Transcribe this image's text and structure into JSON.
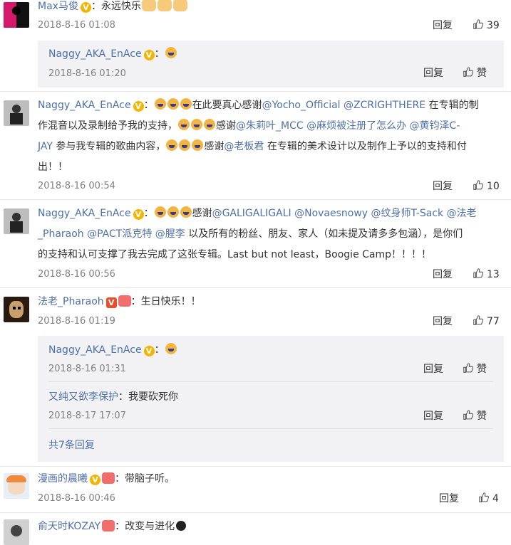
{
  "comments": [
    {
      "name": "Max马俊",
      "text": "：永远快乐",
      "time": "2018-8-16 01:08",
      "reply_label": "回复",
      "likes": "39"
    },
    {
      "name": "Naggy_AKA_EnAce",
      "line1": "在此要真心感谢",
      "mention1": "@Yocho_Official",
      "mention2": "@ZCRIGHTHERE",
      "line1b": "在专辑的制",
      "line2": "作混音以及录制给予我的支持，",
      "line2b": "感谢",
      "mention3": "@朱莉叶_MCC",
      "mention4": "@麻烦被注册了怎么办",
      "mention5": "@黄钧泽C-",
      "mention5b": "JAY",
      "line3": "参与我专辑的歌曲内容，",
      "line3b": "感谢",
      "mention6": "@老板君",
      "line3c": "在专辑的美术设计以及制作上予以的支持和付",
      "line4": "出！！",
      "time": "2018-8-16 00:54",
      "reply_label": "回复",
      "likes": "10"
    },
    {
      "name": "Naggy_AKA_EnAce",
      "line1": "感谢",
      "mention1": "@GALIGALIGALI",
      "mention2": "@Novaesnowy",
      "mention3": "@纹身师T-Sack",
      "mention4": "@法老",
      "mention4b": "_Pharaoh",
      "mention5": "@PACT派克特",
      "mention6": "@腥李",
      "line2": "以及所有的粉丝、朋友、家人（如未提及请多多包涵），是你们",
      "line3": "的支持和认可支撑了我去完成了这张专辑。Last but not least，Boogie Camp！！！！",
      "time": "2018-8-16 00:56",
      "reply_label": "回复",
      "likes": "13"
    },
    {
      "name": "法老_Pharaoh",
      "text": "：生日快乐！！",
      "time": "2018-8-16 01:19",
      "reply_label": "回复",
      "likes": "77"
    },
    {
      "name": "漫画的晨曦",
      "text": "：带脑子听。",
      "time": "2018-8-16 00:46",
      "reply_label": "回复",
      "likes": "4"
    },
    {
      "name": "俞天时KOZAY",
      "text": "：改变与进化"
    }
  ],
  "replies_top": {
    "name": "Naggy_AKA_EnAce",
    "time": "2018-8-16 01:20",
    "reply_label": "回复",
    "like_label": "赞"
  },
  "replies_pharaoh": [
    {
      "name": "Naggy_AKA_EnAce",
      "time": "2018-8-16 01:31",
      "reply_label": "回复",
      "like_label": "赞"
    },
    {
      "name": "又纯又欲李保护",
      "text": "：我要砍死你",
      "time": "2018-8-17 17:07",
      "reply_label": "回复",
      "like_label": "赞"
    }
  ],
  "more_replies": "共7条回复",
  "colon": "：",
  "colors": {
    "link": "#4e70a8",
    "meta": "#808080",
    "reply_bg": "#f2f2f5"
  }
}
